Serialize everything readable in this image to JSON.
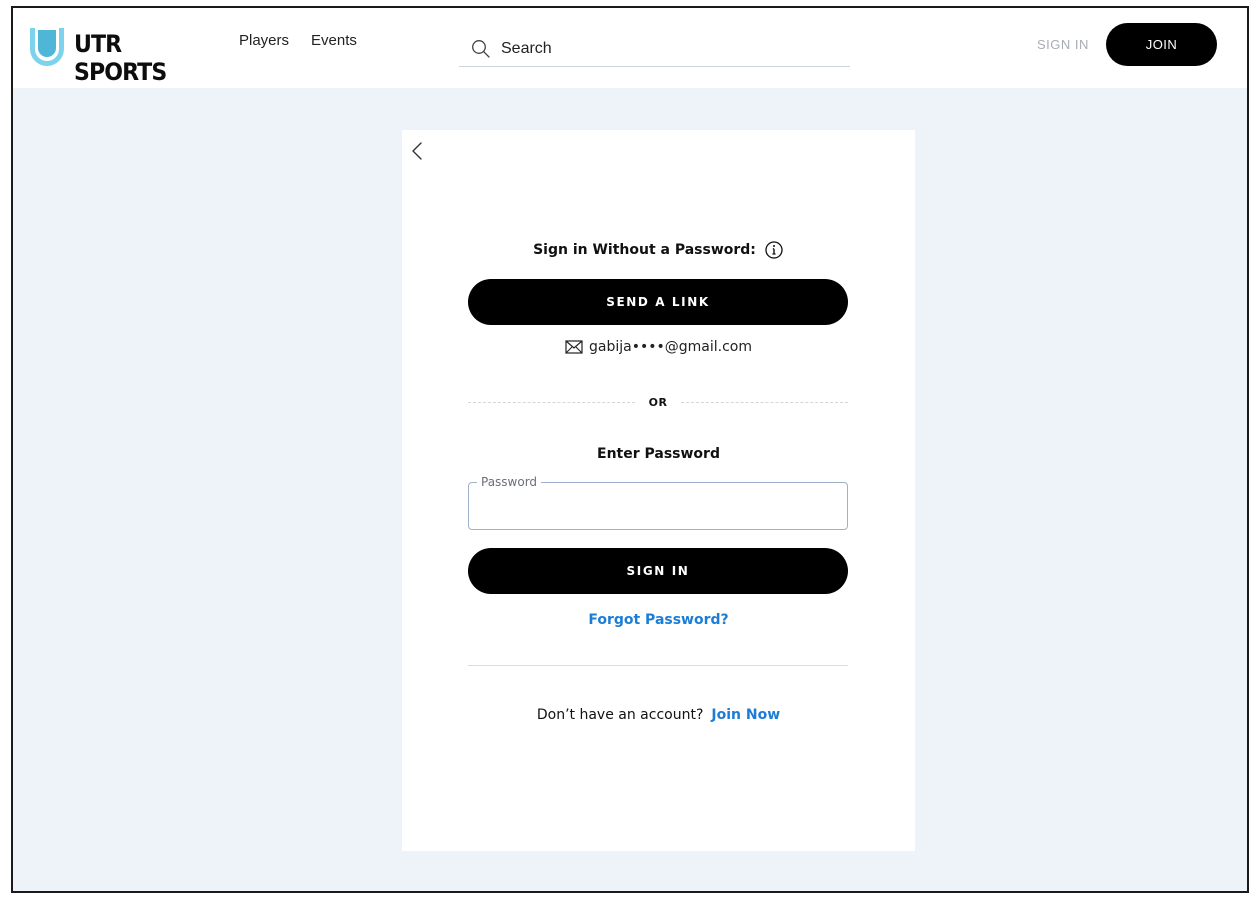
{
  "header": {
    "logo_text": "UTR SPORTS",
    "nav": [
      "Players",
      "Events"
    ],
    "search_placeholder": "Search",
    "signin_label": "SIGN IN",
    "join_label": "JOIN"
  },
  "card": {
    "passwordless_title": "Sign in Without a Password:",
    "send_link_label": "SEND A LINK",
    "masked_email": "gabija••••@gmail.com",
    "or_label": "OR",
    "enter_password_title": "Enter Password",
    "password_field_label": "Password",
    "password_value": "",
    "signin_button_label": "SIGN IN",
    "forgot_password_label": "Forgot Password?",
    "no_account_text": "Don’t have an account?",
    "join_now_label": "Join Now"
  },
  "icons": {
    "logo": "utr-logo-icon",
    "search": "search-icon",
    "back": "back-chevron-icon",
    "info": "info-icon",
    "mail": "mail-icon"
  },
  "colors": {
    "brand_blue": "#4fb6d8",
    "link_blue": "#1c7dd6",
    "page_background": "#eef2f9",
    "button_black": "#000000"
  }
}
